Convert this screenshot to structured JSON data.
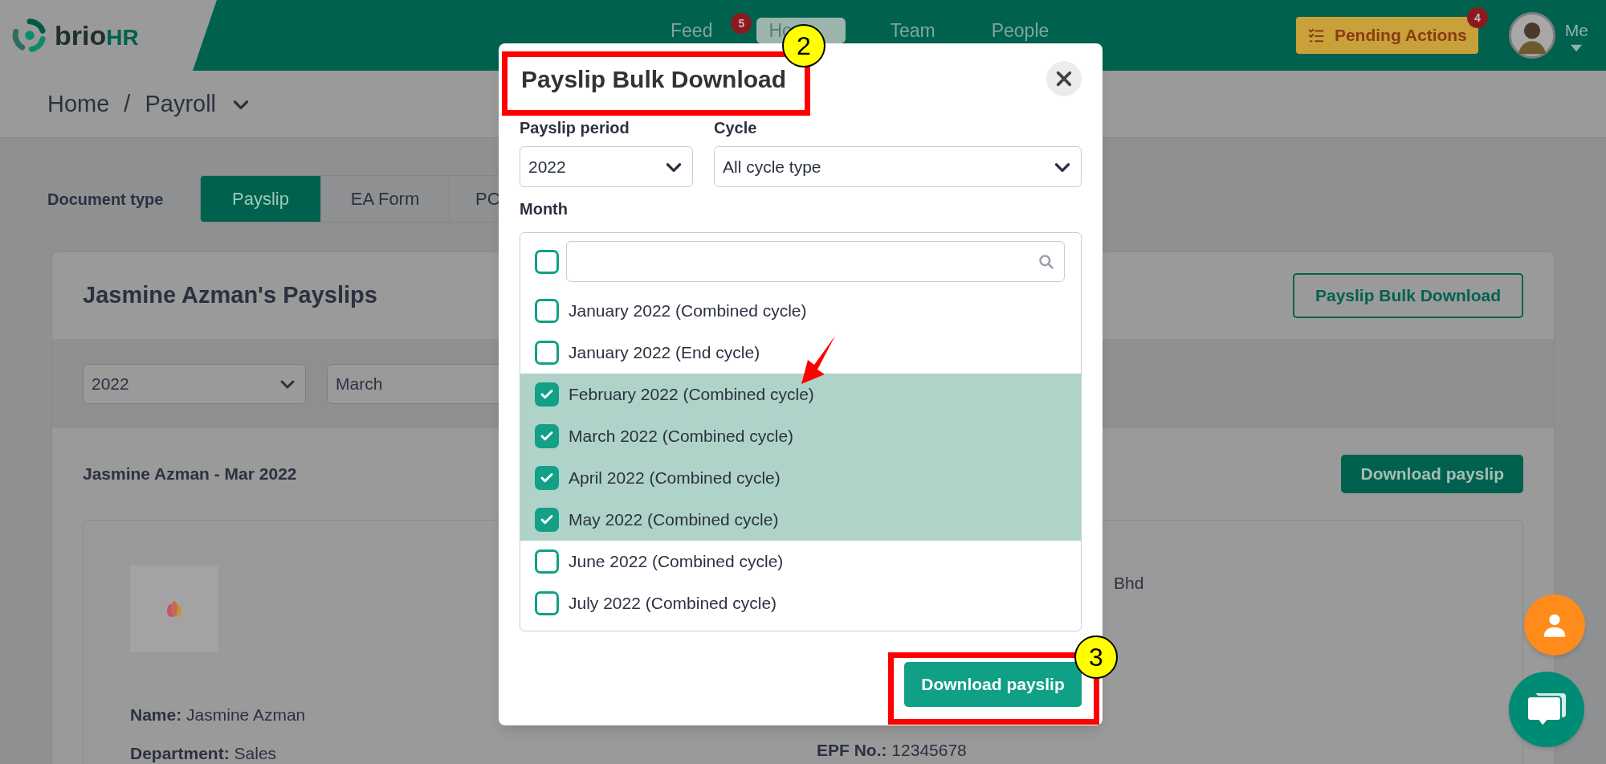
{
  "top_bar": {
    "logo": {
      "name": "brio",
      "accent": "HR"
    },
    "nav": [
      {
        "label": "Feed",
        "badge": "5",
        "selected": false
      },
      {
        "label": "Ho",
        "selected": true
      },
      {
        "label": "Team",
        "selected": false
      },
      {
        "label": "People",
        "selected": false
      }
    ],
    "pending_actions": {
      "label": "Pending Actions",
      "badge": "4"
    },
    "user": {
      "label": "Me"
    }
  },
  "breadcrumb": {
    "items": [
      "Home",
      "Payroll"
    ],
    "separator": "/"
  },
  "document_type": {
    "label": "Document type",
    "tabs": [
      {
        "label": "Payslip",
        "selected": true
      },
      {
        "label": "EA Form",
        "selected": false
      },
      {
        "label": "PC",
        "selected": false
      }
    ]
  },
  "payslips_card": {
    "title": "Jasmine Azman's Payslips",
    "bulk_button": "Payslip Bulk Download",
    "year_select": "2022",
    "month_select": "March",
    "payslip_title": "Jasmine Azman - Mar 2022",
    "download_button": "Download payslip",
    "company_fragment": "Bhd",
    "details_left": [
      {
        "label": "Name:",
        "value": "Jasmine Azman"
      },
      {
        "label": "Department:",
        "value": "Sales"
      }
    ],
    "details_right": [
      {
        "label": "EPF No.:",
        "value": "12345678"
      }
    ]
  },
  "dialog": {
    "title": "Payslip Bulk Download",
    "period_label": "Payslip period",
    "period_value": "2022",
    "cycle_label": "Cycle",
    "cycle_value": "All cycle type",
    "month_label": "Month",
    "select_all": {
      "checked": false
    },
    "months": [
      {
        "label": "January 2022 (Combined cycle)",
        "checked": false
      },
      {
        "label": "January 2022 (End cycle)",
        "checked": false
      },
      {
        "label": "February 2022 (Combined cycle)",
        "checked": true
      },
      {
        "label": "March 2022 (Combined cycle)",
        "checked": true
      },
      {
        "label": "April 2022 (Combined cycle)",
        "checked": true
      },
      {
        "label": "May 2022 (Combined cycle)",
        "checked": true
      },
      {
        "label": "June 2022 (Combined cycle)",
        "checked": false
      },
      {
        "label": "July 2022 (Combined cycle)",
        "checked": false
      }
    ],
    "download_button": "Download payslip"
  },
  "annotations": [
    {
      "number": "2"
    },
    {
      "number": "3"
    }
  ]
}
